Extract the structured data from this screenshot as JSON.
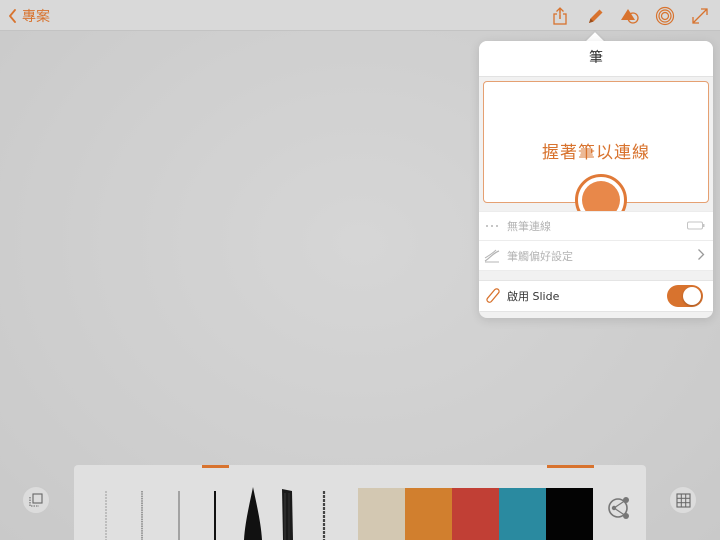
{
  "header": {
    "back_label": "專案",
    "tools": [
      "share-icon",
      "pencil-icon",
      "shapes-icon",
      "ring-icon",
      "expand-icon"
    ]
  },
  "popover": {
    "title": "筆",
    "prompt": "握著筆以連線",
    "rows": [
      {
        "label": "無筆連線",
        "icon": "dots-icon",
        "enabled": false
      },
      {
        "label": "筆觸偏好設定",
        "icon": "stroke-icon",
        "enabled": false
      },
      {
        "label": "啟用 Slide",
        "icon": "stylus-icon",
        "enabled": true,
        "toggle_on": true
      }
    ]
  },
  "palette": {
    "colors": [
      "#d3c8b2",
      "#d17f2e",
      "#c13f35",
      "#2a8aa0",
      "#030303"
    ]
  },
  "colors": {
    "accent": "#d8732e"
  }
}
